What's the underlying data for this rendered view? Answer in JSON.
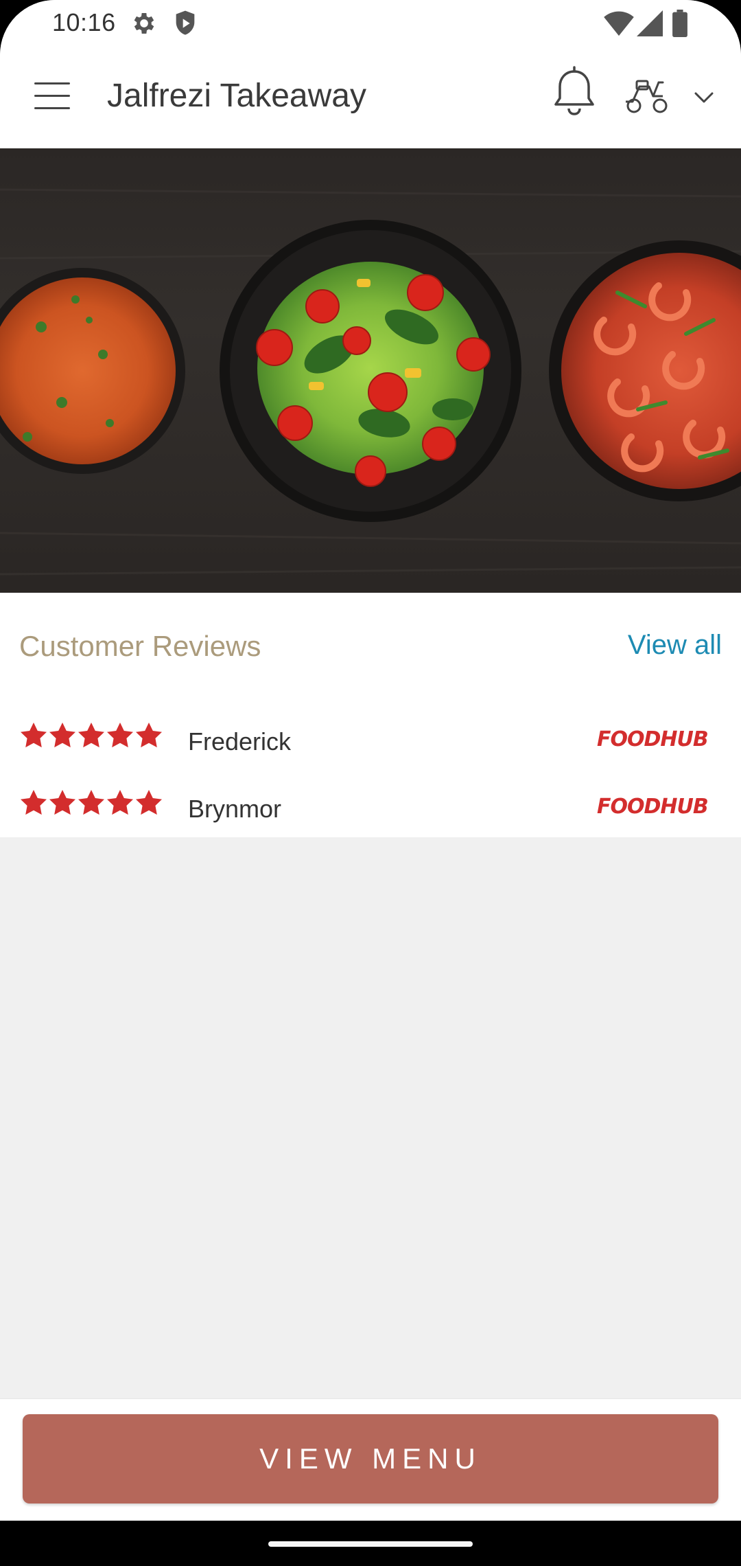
{
  "status_bar": {
    "time": "10:16",
    "left_icons": [
      "settings-icon",
      "shield-icon"
    ],
    "right_icons": [
      "wifi-icon",
      "signal-icon",
      "battery-icon"
    ]
  },
  "app_bar": {
    "title": "Jalfrezi Takeaway",
    "icons": [
      "hamburger-menu-icon",
      "bell-icon",
      "scooter-icon",
      "chevron-down-icon"
    ]
  },
  "hero": {
    "image": "food-dishes-banner"
  },
  "reviews": {
    "title": "Customer Reviews",
    "view_all": "View all",
    "items": [
      {
        "name": "Frederick",
        "rating": 5,
        "source": "FOODHUB"
      },
      {
        "name": "Brynmor",
        "rating": 5,
        "source": "FOODHUB"
      }
    ]
  },
  "actions": {
    "view_menu": "VIEW MENU"
  },
  "colors": {
    "accent_button": "#b5675a",
    "reviews_title": "#ab9b7c",
    "link": "#1d8bb3",
    "stars": "#d32d2d",
    "background": "#f0f0f0"
  }
}
